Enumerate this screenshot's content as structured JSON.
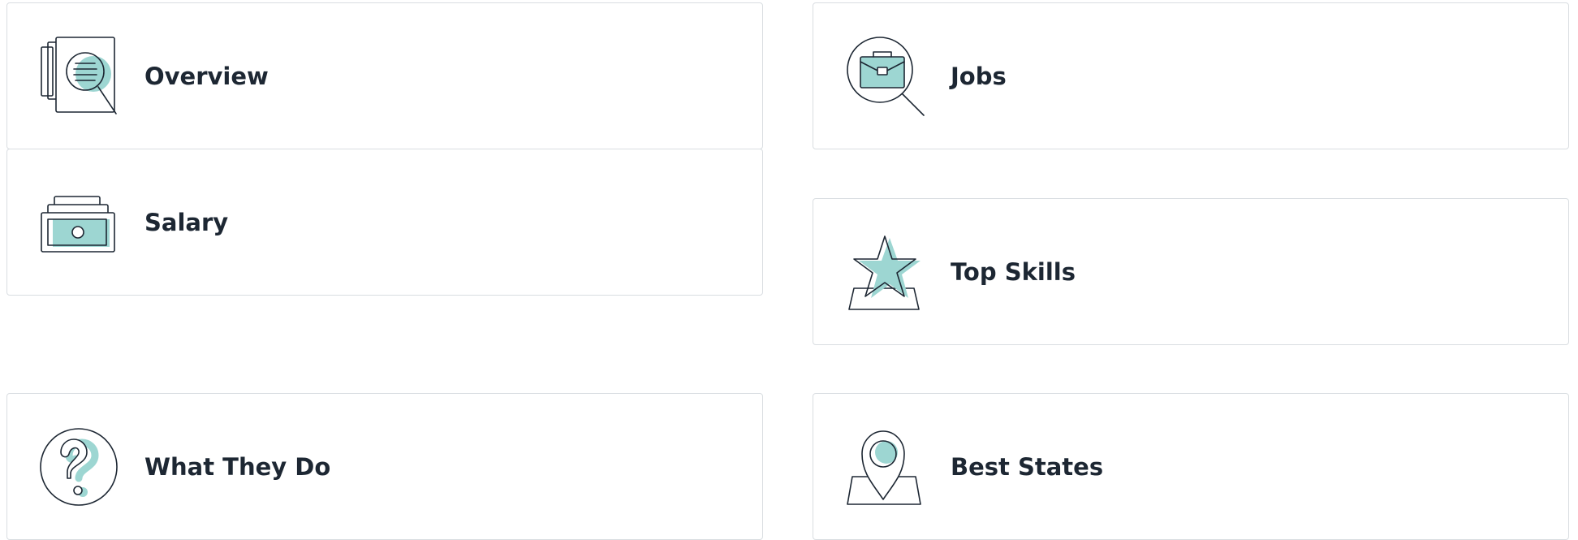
{
  "theme": {
    "accent": "#9dd6d2",
    "stroke": "#1d2733",
    "border": "#d9dde1"
  },
  "cards": [
    {
      "label": "Overview",
      "icon": "document-search-icon"
    },
    {
      "label": "Jobs",
      "icon": "briefcase-search-icon"
    },
    {
      "label": "Salary",
      "icon": "money-stack-icon"
    },
    {
      "label": "Top Skills",
      "icon": "star-podium-icon"
    },
    {
      "label": "What They Do",
      "icon": "question-mark-icon"
    },
    {
      "label": "Best States",
      "icon": "map-pin-icon"
    }
  ]
}
